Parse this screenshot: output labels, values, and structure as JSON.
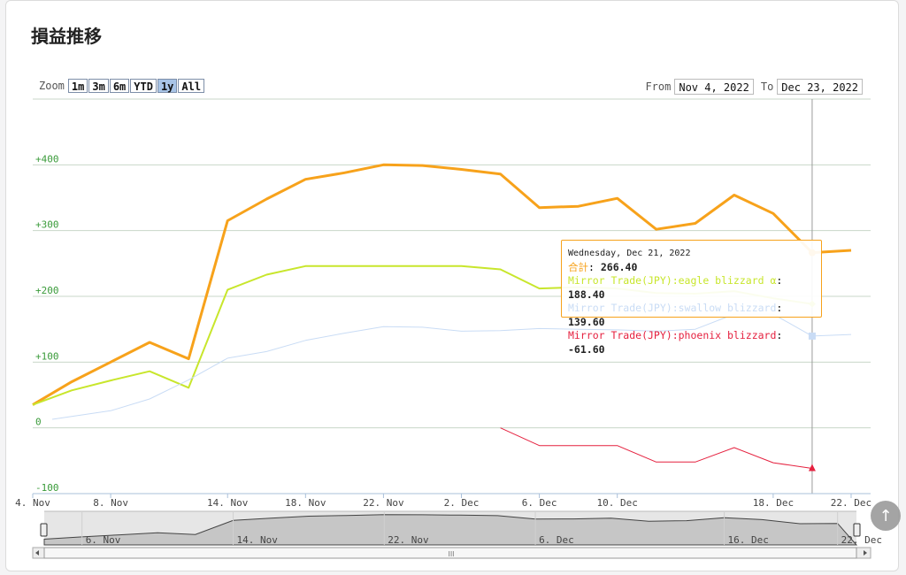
{
  "page_title": "損益推移",
  "zoom": {
    "label": "Zoom",
    "buttons": [
      "1m",
      "3m",
      "6m",
      "YTD",
      "1y",
      "All"
    ],
    "active": "1y"
  },
  "range": {
    "from_label": "From",
    "from_value": "Nov 4, 2022",
    "to_label": "To",
    "to_value": "Dec 23, 2022"
  },
  "colors": {
    "total": "#f7a21b",
    "eagle": "#c8e62c",
    "swallow": "#c9dcf5",
    "phoenix": "#e5213f",
    "grid": "#c8d7c8",
    "ylabel": "#3a9b3a"
  },
  "chart_data": {
    "type": "line",
    "ylim": [
      -100,
      500
    ],
    "y_ticks": [
      "+400",
      "+300",
      "+200",
      "+100",
      "0",
      "-100"
    ],
    "y_tick_values": [
      400,
      300,
      200,
      100,
      0,
      -100
    ],
    "x_tick_labels": [
      "4. Nov",
      "8. Nov",
      "14. Nov",
      "18. Nov",
      "22. Nov",
      "2. Dec",
      "6. Dec",
      "10. Dec",
      "18. Dec",
      "22. Dec"
    ],
    "x_tick_dates": [
      "2022-11-04",
      "2022-11-08",
      "2022-11-14",
      "2022-11-18",
      "2022-11-22",
      "2022-11-26",
      "2022-11-30",
      "2022-12-04",
      "2022-12-12",
      "2022-12-16"
    ],
    "navigator_tick_labels": [
      "6. Nov",
      "14. Nov",
      "22. Nov",
      "6. Dec",
      "16. Dec",
      "22. Dec"
    ],
    "navigator_tick_dates": [
      "2022-11-06",
      "2022-11-14",
      "2022-11-22",
      "2022-11-30",
      "2022-12-10",
      "2022-12-16"
    ],
    "series": [
      {
        "name": "合計",
        "key": "total",
        "width": 3,
        "points": [
          [
            "2022-11-04",
            35
          ],
          [
            "2022-11-06",
            70
          ],
          [
            "2022-11-08",
            100
          ],
          [
            "2022-11-10",
            130
          ],
          [
            "2022-11-12",
            105
          ],
          [
            "2022-11-14",
            315
          ],
          [
            "2022-11-16",
            348
          ],
          [
            "2022-11-18",
            378
          ],
          [
            "2022-11-20",
            388
          ],
          [
            "2022-11-22",
            400
          ],
          [
            "2022-11-24",
            399
          ],
          [
            "2022-11-26",
            393
          ],
          [
            "2022-11-28",
            386
          ],
          [
            "2022-11-30",
            335
          ],
          [
            "2022-12-02",
            337
          ],
          [
            "2022-12-04",
            349
          ],
          [
            "2022-12-06",
            302
          ],
          [
            "2022-12-08",
            311
          ],
          [
            "2022-12-10",
            354
          ],
          [
            "2022-12-12",
            326
          ],
          [
            "2022-12-14",
            266.4
          ],
          [
            "2022-12-16",
            270
          ]
        ]
      },
      {
        "name": "Mirror Trade(JPY):eagle blizzard α",
        "key": "eagle",
        "width": 2,
        "points": [
          [
            "2022-11-04",
            35
          ],
          [
            "2022-11-06",
            57
          ],
          [
            "2022-11-08",
            72
          ],
          [
            "2022-11-10",
            86
          ],
          [
            "2022-11-12",
            61
          ],
          [
            "2022-11-14",
            210
          ],
          [
            "2022-11-16",
            233
          ],
          [
            "2022-11-18",
            246
          ],
          [
            "2022-11-20",
            246
          ],
          [
            "2022-11-22",
            246
          ],
          [
            "2022-11-24",
            246
          ],
          [
            "2022-11-26",
            246
          ],
          [
            "2022-11-28",
            241
          ],
          [
            "2022-11-30",
            212
          ],
          [
            "2022-12-02",
            214
          ],
          [
            "2022-12-04",
            212
          ],
          [
            "2022-12-06",
            205
          ],
          [
            "2022-12-08",
            204
          ],
          [
            "2022-12-10",
            208
          ],
          [
            "2022-12-12",
            197
          ],
          [
            "2022-12-14",
            188.4
          ]
        ]
      },
      {
        "name": "Mirror Trade(JPY):swallow blizzard",
        "key": "swallow",
        "width": 1,
        "points": [
          [
            "2022-11-05",
            13
          ],
          [
            "2022-11-08",
            26
          ],
          [
            "2022-11-10",
            44
          ],
          [
            "2022-11-12",
            73
          ],
          [
            "2022-11-14",
            106
          ],
          [
            "2022-11-16",
            116
          ],
          [
            "2022-11-18",
            133
          ],
          [
            "2022-11-20",
            144
          ],
          [
            "2022-11-22",
            154
          ],
          [
            "2022-11-24",
            153
          ],
          [
            "2022-11-26",
            147
          ],
          [
            "2022-11-28",
            148
          ],
          [
            "2022-11-30",
            151
          ],
          [
            "2022-12-02",
            150
          ],
          [
            "2022-12-04",
            149
          ],
          [
            "2022-12-06",
            147
          ],
          [
            "2022-12-08",
            150
          ],
          [
            "2022-12-10",
            173
          ],
          [
            "2022-12-12",
            173
          ],
          [
            "2022-12-14",
            139.6
          ],
          [
            "2022-12-16",
            142
          ]
        ]
      },
      {
        "name": "Mirror Trade(JPY):phoenix blizzard",
        "key": "phoenix",
        "width": 1,
        "points": [
          [
            "2022-11-28",
            0
          ],
          [
            "2022-11-30",
            -27
          ],
          [
            "2022-12-02",
            -27
          ],
          [
            "2022-12-04",
            -27
          ],
          [
            "2022-12-06",
            -52
          ],
          [
            "2022-12-08",
            -52
          ],
          [
            "2022-12-10",
            -30
          ],
          [
            "2022-12-12",
            -53
          ],
          [
            "2022-12-14",
            -61.6
          ]
        ]
      }
    ]
  },
  "tooltip": {
    "date": "Wednesday, Dec 21, 2022",
    "rows": [
      {
        "name": "合計",
        "value": "266.40",
        "key": "total"
      },
      {
        "name": "Mirror Trade(JPY):eagle blizzard α",
        "value": "188.40",
        "key": "eagle"
      },
      {
        "name": "Mirror Trade(JPY):swallow blizzard",
        "value": "139.60",
        "key": "swallow"
      },
      {
        "name": "Mirror Trade(JPY):phoenix blizzard",
        "value": "-61.60",
        "key": "phoenix"
      }
    ],
    "date_value": "2022-12-14"
  },
  "navigator": {
    "scroll_grip": "III"
  },
  "scroll_top_icon": "↑"
}
